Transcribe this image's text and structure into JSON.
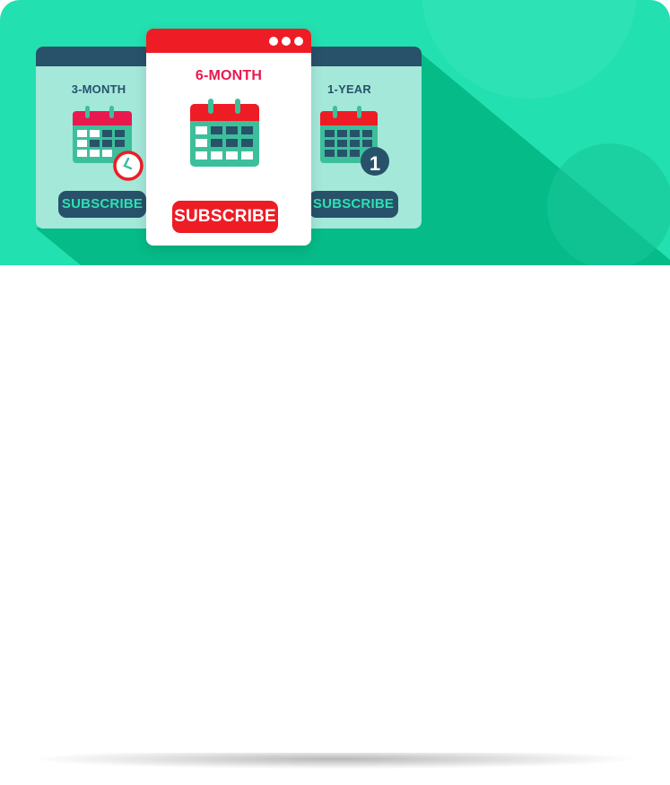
{
  "plans": [
    {
      "id": "3-month",
      "title": "3-MONTH",
      "button": "SUBSCRIBE",
      "icon": "calendar-clock-icon"
    },
    {
      "id": "6-month",
      "title": "6-MONTH",
      "button": "SUBSCRIBE",
      "icon": "calendar-icon",
      "featured": true
    },
    {
      "id": "1-year",
      "title": "1-YEAR",
      "button": "SUBSCRIBE",
      "icon": "calendar-badge-icon",
      "badge": "1"
    }
  ],
  "colors": {
    "hero_bg": "#22e0b0",
    "accent_red": "#ee1c25",
    "navy": "#27526a",
    "side_card": "#a4e8da",
    "calendar_green": "#3dbf9b"
  }
}
